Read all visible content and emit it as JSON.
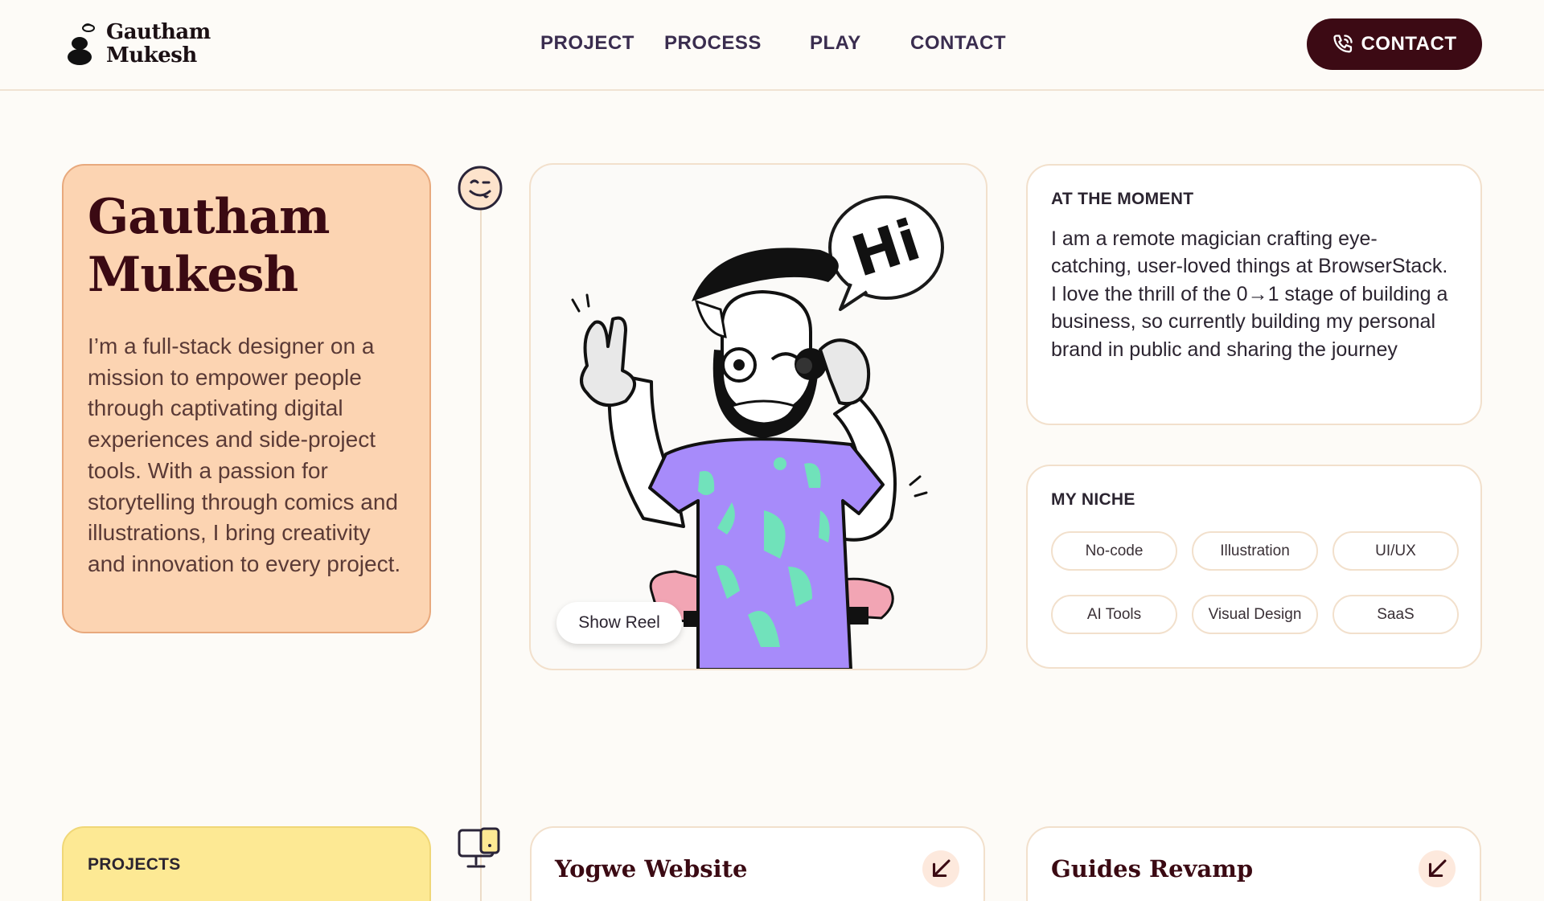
{
  "brand": {
    "name_line1": "Gautham",
    "name_line2": "Mukesh"
  },
  "nav": [
    {
      "label": "PROJECT"
    },
    {
      "label": "PROCESS"
    },
    {
      "label": "PLAY"
    },
    {
      "label": "CONTACT"
    }
  ],
  "cta": {
    "label": "CONTACT",
    "icon": "phone-icon"
  },
  "intro": {
    "name_line1": "Gautham",
    "name_line2": "Mukesh",
    "bio": "I’m a full-stack designer on a mission to empower people through captivating digital experiences and side-project tools. With a passion for storytelling through comics and illustrations, I bring creativity and innovation to every project."
  },
  "illustration": {
    "speech": "Hi",
    "button": "Show Reel"
  },
  "at_the_moment": {
    "label": "AT THE MOMENT",
    "text": "I am a remote magician crafting eye-catching, user-loved things at BrowserStack. I love the thrill of the 0→1 stage of building a business, so currently building my personal brand in public and sharing the journey"
  },
  "niche": {
    "label": "MY NICHE",
    "tags": [
      "No-code",
      "Illustration",
      "UI/UX",
      "AI Tools",
      "Visual Design",
      "SaaS"
    ]
  },
  "projects": {
    "label": "PROJECTS",
    "items": [
      {
        "title": "Yogwe Website"
      },
      {
        "title": "Guides Revamp"
      }
    ]
  },
  "colors": {
    "accent_dark": "#3c0a14",
    "intro_bg": "#fcd4b2",
    "projects_bg": "#fde994",
    "nav_text": "#3a2d4f"
  }
}
